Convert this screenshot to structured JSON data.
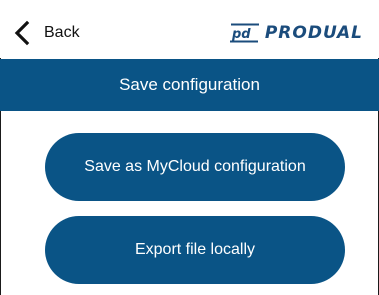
{
  "header": {
    "back_label": "Back",
    "brand": "PRODUAL",
    "icons": {
      "back": "chevron-left-icon",
      "logo": "produal-logo-mark"
    }
  },
  "title_bar": {
    "title": "Save configuration"
  },
  "actions": [
    {
      "label": "Save as MyCloud configuration"
    },
    {
      "label": "Export file locally"
    }
  ],
  "colors": {
    "primary": "#0a5486",
    "brand_text": "#1b4c7c",
    "background": "#ffffff",
    "text_on_primary": "#ffffff"
  }
}
